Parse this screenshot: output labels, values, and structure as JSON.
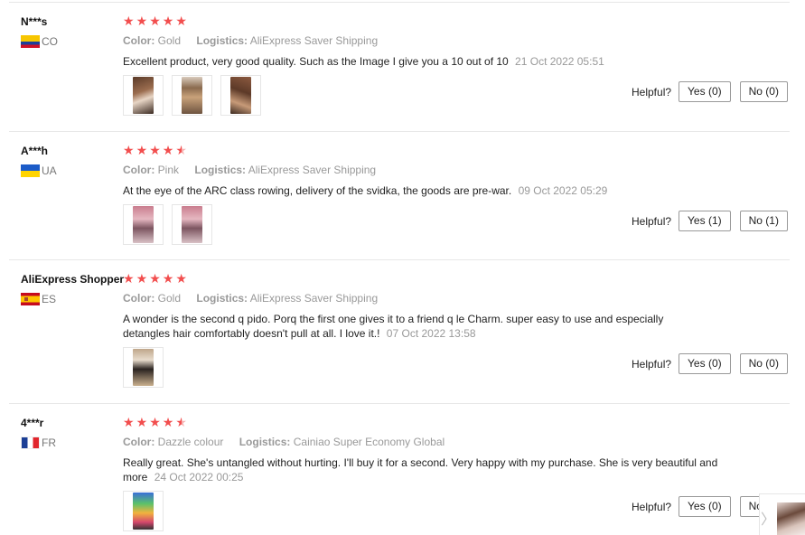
{
  "helpful_label": "Helpful?",
  "reviews": [
    {
      "user": "N***s",
      "country": "CO",
      "stars": [
        "★",
        "★",
        "★",
        "★",
        "★"
      ],
      "rating": 5,
      "color_label": "Color:",
      "color_value": "Gold",
      "logistics_label": "Logistics:",
      "logistics_value": "AliExpress Saver Shipping",
      "text": "Excellent product, very good quality. Such as the Image I give you a 10 out of 10",
      "date": "21 Oct 2022 05:51",
      "yes_label": "Yes (0)",
      "no_label": "No (0)"
    },
    {
      "user": "A***h",
      "country": "UA",
      "stars": [
        "★",
        "★",
        "★",
        "★",
        "★"
      ],
      "rating": 4.5,
      "color_label": "Color:",
      "color_value": "Pink",
      "logistics_label": "Logistics:",
      "logistics_value": "AliExpress Saver Shipping",
      "text": "At the eye of the ARC class rowing, delivery of the svidka, the goods are pre-war.",
      "date": "09 Oct 2022 05:29",
      "yes_label": "Yes (1)",
      "no_label": "No (1)"
    },
    {
      "user": "AliExpress Shopper",
      "country": "ES",
      "stars": [
        "★",
        "★",
        "★",
        "★",
        "★"
      ],
      "rating": 5,
      "color_label": "Color:",
      "color_value": "Gold",
      "logistics_label": "Logistics:",
      "logistics_value": "AliExpress Saver Shipping",
      "text": "A wonder is the second q pido. Porq the first one gives it to a friend q le Charm. super easy to use and especially detangles hair comfortably doesn't pull at all. I love it.!",
      "date": "07 Oct 2022 13:58",
      "yes_label": "Yes (0)",
      "no_label": "No (0)"
    },
    {
      "user": "4***r",
      "country": "FR",
      "stars": [
        "★",
        "★",
        "★",
        "★",
        "★"
      ],
      "rating": 4.5,
      "color_label": "Color:",
      "color_value": "Dazzle colour",
      "logistics_label": "Logistics:",
      "logistics_value": "Cainiao Super Economy Global",
      "text": "Really great. She's untangled without hurting. I'll buy it for a second. Very happy with my purchase. She is very beautiful and more",
      "date": "24 Oct 2022 00:25",
      "yes_label": "Yes (0)",
      "no_label": "No"
    }
  ],
  "next_arrow": "〉"
}
